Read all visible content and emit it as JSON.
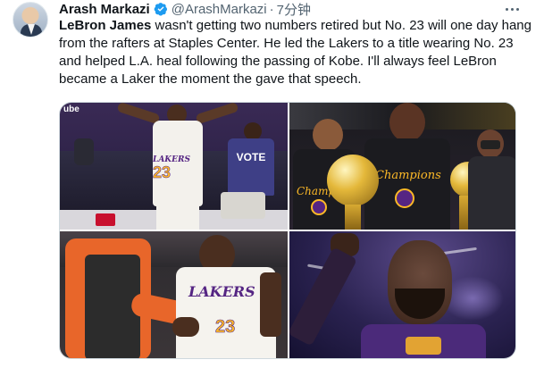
{
  "tweet": {
    "author_name": "Arash Markazi",
    "author_handle": "@ArashMarkazi",
    "separator": "·",
    "timestamp": "7分钟",
    "text_mention": "LeBron James",
    "text_body": " wasn't getting two numbers retired but No. 23 will one day hang from the rafters at Staples Center. He led the Lakers to a title wearing No. 23 and helped L.A. heal following the passing of Kobe. I'll always feel LeBron became a Laker the moment the gave that speech."
  },
  "media": {
    "photo1": {
      "corner_text": "ube",
      "jersey_word": "LAKERS",
      "jersey_number": "23",
      "shirt_text": "VOTE"
    },
    "photo2": {
      "shirt_text": "Champions",
      "shirt_text_2": "Champions"
    },
    "photo3": {
      "jersey_word": "LAKERS",
      "jersey_number": "23"
    },
    "photo4": {}
  },
  "colors": {
    "verified_badge": "#1d9bf0",
    "text_primary": "#0f1419",
    "text_secondary": "#536471",
    "lakers_purple": "#552583",
    "lakers_gold": "#fdb927"
  },
  "icons": [
    "verified-badge-icon",
    "more-options-icon"
  ]
}
